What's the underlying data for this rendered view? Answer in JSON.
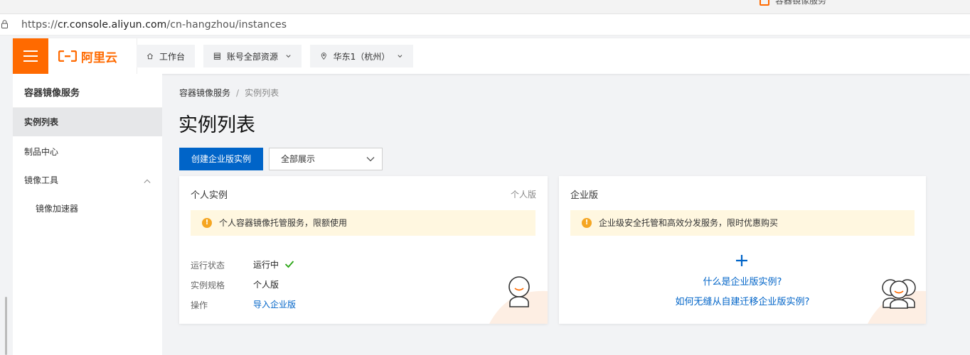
{
  "browser": {
    "tab_title": "容器镜像服务",
    "url_scheme": "https://",
    "url_host": "cr.console.aliyun.com",
    "url_path": "/cn-hangzhou/instances"
  },
  "topnav": {
    "logo_text": "阿里云",
    "workbench": "工作台",
    "resource_group": "账号全部资源",
    "region": "华东1（杭州）"
  },
  "sidebar": {
    "title": "容器镜像服务",
    "items": [
      {
        "label": "实例列表"
      },
      {
        "label": "制品中心"
      },
      {
        "label": "镜像工具"
      },
      {
        "label": "镜像加速器"
      }
    ]
  },
  "main": {
    "breadcrumb": [
      "容器镜像服务",
      "实例列表"
    ],
    "breadcrumb_sep": "/",
    "title": "实例列表",
    "create_button": "创建企业版实例",
    "filter_value": "全部展示"
  },
  "cards": {
    "personal": {
      "title": "个人实例",
      "tag": "个人版",
      "alert": "个人容器镜像托管服务，限额使用",
      "rows": [
        {
          "label": "运行状态",
          "value": "运行中"
        },
        {
          "label": "实例规格",
          "value": "个人版"
        },
        {
          "label": "操作",
          "value": "导入企业版"
        }
      ]
    },
    "enterprise": {
      "title": "企业版",
      "alert": "企业级安全托管和高效分发服务，限时优惠购买",
      "links": [
        "什么是企业版实例?",
        "如何无缝从自建迁移企业版实例?"
      ]
    }
  },
  "colors": {
    "brand_orange": "#ff6a00",
    "primary_blue": "#0064c8",
    "warning": "#f5a623",
    "success": "#2aa515"
  }
}
